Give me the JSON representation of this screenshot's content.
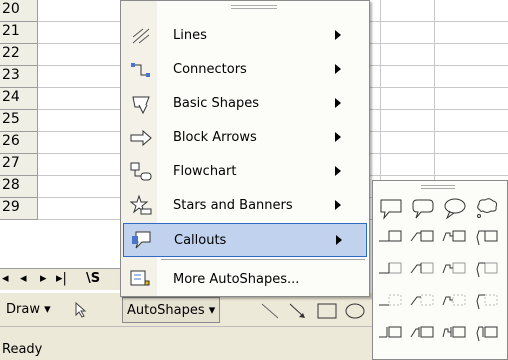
{
  "grid": {
    "rows": [
      "20",
      "21",
      "22",
      "23",
      "24",
      "25",
      "26",
      "27",
      "28",
      "29"
    ]
  },
  "sheet_tabs": {
    "nav_first": "◂",
    "nav_prev": "◂",
    "nav_next": "▸",
    "nav_last": "▸|",
    "tab_label": "\\S"
  },
  "menu": {
    "items": [
      {
        "label": "Lines",
        "icon": "lines-icon",
        "submenu": true
      },
      {
        "label": "Connectors",
        "icon": "connectors-icon",
        "submenu": true
      },
      {
        "label": "Basic Shapes",
        "icon": "basic-shapes-icon",
        "submenu": true
      },
      {
        "label": "Block Arrows",
        "icon": "block-arrows-icon",
        "submenu": true
      },
      {
        "label": "Flowchart",
        "icon": "flowchart-icon",
        "submenu": true
      },
      {
        "label": "Stars and Banners",
        "icon": "stars-banners-icon",
        "submenu": true
      },
      {
        "label": "Callouts",
        "icon": "callouts-icon",
        "submenu": true,
        "highlighted": true
      },
      {
        "label": "More AutoShapes...",
        "icon": "more-autoshapes-icon",
        "submenu": false
      }
    ]
  },
  "drawing_toolbar": {
    "draw_label": "Draw",
    "autoshapes_label": "AutoShapes"
  },
  "status_bar": {
    "text": "Ready"
  },
  "colors": {
    "highlight": "#c1d2ee",
    "highlight_border": "#316ac5",
    "toolbar_bg": "#ece9d8"
  }
}
